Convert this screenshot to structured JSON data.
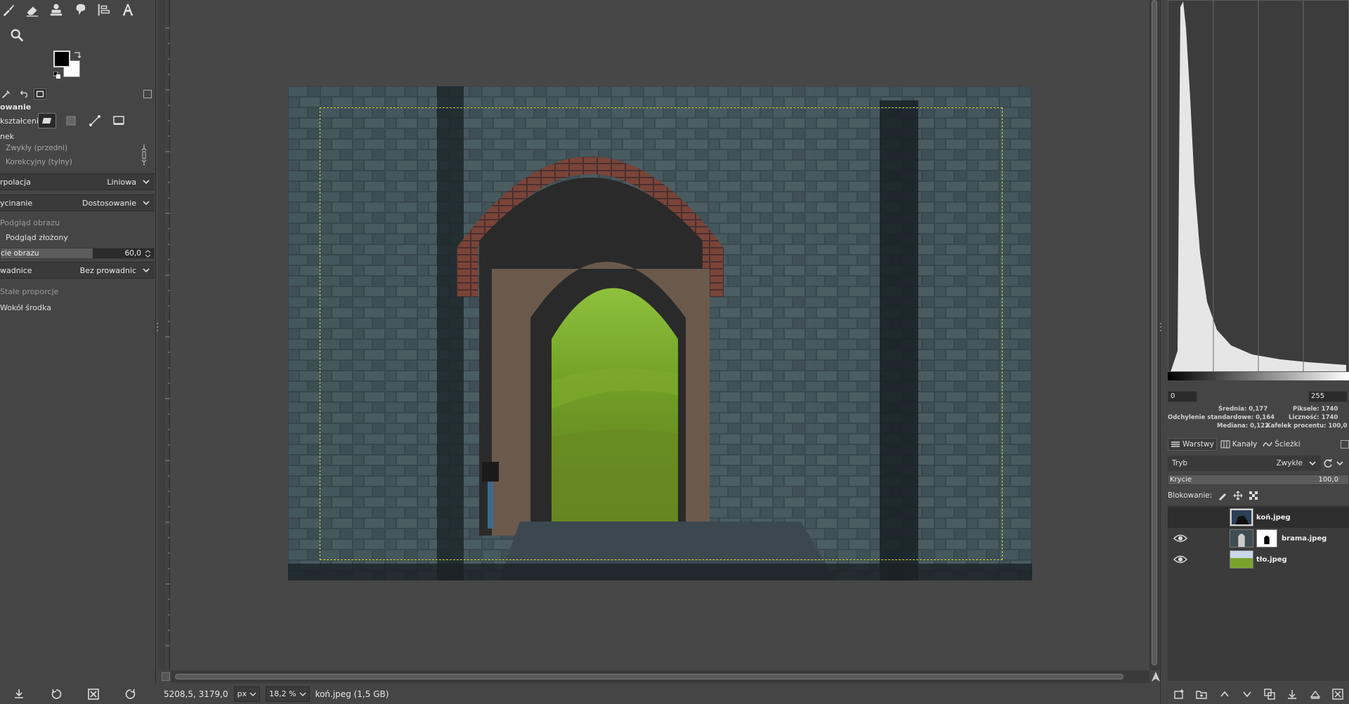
{
  "toolbox": {
    "tools_row1": [
      "paintbrush-icon",
      "eraser-icon",
      "clone-icon",
      "smudge-icon",
      "align-icon",
      "text-icon"
    ],
    "tools_row2": [
      "magnify-icon"
    ],
    "fg_color": "#000000",
    "bg_color": "#ffffff"
  },
  "tool_options": {
    "title": "owanie",
    "transform_label": "kształcenie:",
    "direction_label": "nek",
    "direction_normal": "Zwykły (przedni)",
    "direction_corrective": "Korekcyjny (tylny)",
    "interpolation_label": "rpolacja",
    "interpolation_value": "Liniowa",
    "clipping_label": "ycinanie",
    "clipping_value": "Dostosowanie",
    "preview_label": "Podgląd obrazu",
    "composite_preview": "Podgląd złożony",
    "opacity_label": "cie obrazu",
    "opacity_value": "60,0",
    "opacity_fraction": 0.6,
    "guides_label": "wadnice",
    "guides_value": "Bez prowadnic",
    "constraint_label": "Stałe proporcje",
    "around_center": "Wokół środka"
  },
  "status": {
    "coords": "5208,5, 3179,0",
    "unit": "px",
    "zoom": "18,2 %",
    "file_info": "koń.jpeg (1,5 GB)"
  },
  "histogram": {
    "range_min": "0",
    "range_max": "255",
    "mean_label": "Średnia:",
    "mean_value": "0,177",
    "std_label": "Odchylenie standardowe:",
    "std_value": "0,164",
    "median_label": "Mediana:",
    "median_value": "0,122",
    "pixels_label": "Piksele:",
    "pixels_value": "1740",
    "count_label": "Liczność:",
    "count_value": "1740",
    "percentile_label": "Kafelek procentu:",
    "percentile_value": "100,0"
  },
  "layers_panel": {
    "tabs": [
      "Warstwy",
      "Kanały",
      "Ścieżki"
    ],
    "mode_label": "Tryb",
    "mode_value": "Zwykłe",
    "opacity_label": "Krycie",
    "opacity_value": "100,0",
    "lock_label": "Blokowanie:",
    "layers": [
      {
        "name": "koń.jpeg",
        "visible": false,
        "selected": true
      },
      {
        "name": "brama.jpeg",
        "visible": true,
        "selected": false
      },
      {
        "name": "tło.jpeg",
        "visible": true,
        "selected": false
      }
    ]
  },
  "colors": {
    "selection": "#d8d84a",
    "panel_bg": "#454545",
    "canvas_bg": "#474747"
  }
}
